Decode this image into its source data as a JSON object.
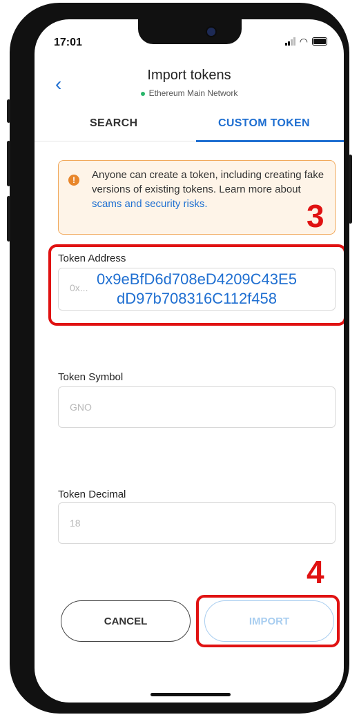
{
  "status_bar": {
    "time": "17:01"
  },
  "header": {
    "back_icon": "chevron-left-icon",
    "title": "Import tokens",
    "network": "Ethereum Main Network"
  },
  "tabs": [
    {
      "label": "SEARCH",
      "active": false
    },
    {
      "label": "CUSTOM TOKEN",
      "active": true
    }
  ],
  "warning": {
    "text": "Anyone can create a token, including creating fake versions of existing tokens. Learn more about ",
    "link": "scams and security risks."
  },
  "fields": {
    "address": {
      "label": "Token Address",
      "placeholder": "0x...",
      "overlay_line1": "0x9eBfD6d708eD4209C43E5",
      "overlay_line2": "dD97b708316C112f458"
    },
    "symbol": {
      "label": "Token Symbol",
      "placeholder": "GNO"
    },
    "decimal": {
      "label": "Token Decimal",
      "placeholder": "18"
    }
  },
  "buttons": {
    "cancel": "CANCEL",
    "import": "IMPORT"
  },
  "annotations": {
    "step_3": "3",
    "step_4": "4"
  },
  "colors": {
    "accent": "#1f6fd1",
    "annotation": "#e01212",
    "warning_bg": "#fef4e8",
    "warning_border": "#f1a85a"
  }
}
